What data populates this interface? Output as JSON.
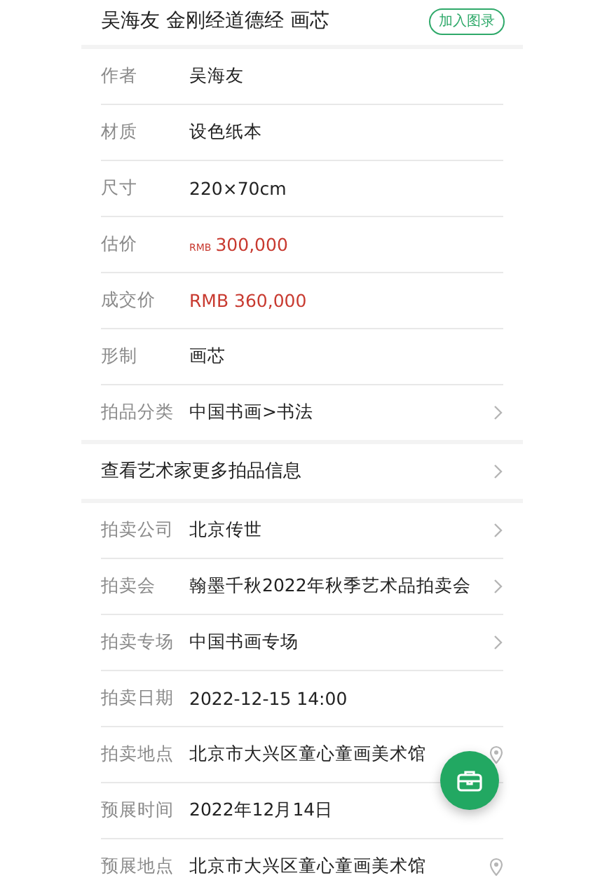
{
  "header": {
    "title": "吴海友 金刚经道德经 画芯",
    "button": "加入图录"
  },
  "groups": [
    {
      "rows": [
        {
          "kind": "field",
          "label": "作者",
          "value": "吴海友",
          "chevron": false,
          "location": false
        },
        {
          "kind": "field",
          "label": "材质",
          "value": "设色纸本",
          "chevron": false,
          "location": false
        },
        {
          "kind": "field",
          "label": "尺寸",
          "value": "220×70cm",
          "chevron": false,
          "location": false
        },
        {
          "kind": "price",
          "label": "估价",
          "currency": "RMB",
          "value": "300,000",
          "chevron": false,
          "location": false
        },
        {
          "kind": "price",
          "label": "成交价",
          "value": "RMB 360,000",
          "chevron": false,
          "location": false
        },
        {
          "kind": "field",
          "label": "形制",
          "value": "画芯",
          "chevron": false,
          "location": false
        },
        {
          "kind": "field",
          "label": "拍品分类",
          "value": "中国书画>书法",
          "chevron": true,
          "location": false
        }
      ]
    },
    {
      "rows": [
        {
          "kind": "link",
          "value": "查看艺术家更多拍品信息",
          "chevron": true,
          "location": false
        }
      ]
    },
    {
      "rows": [
        {
          "kind": "field",
          "label": "拍卖公司",
          "value": "北京传世",
          "chevron": true,
          "location": false
        },
        {
          "kind": "field",
          "label": "拍卖会",
          "value": "翰墨千秋2022年秋季艺术品拍卖会",
          "chevron": true,
          "location": false
        },
        {
          "kind": "field",
          "label": "拍卖专场",
          "value": "中国书画专场",
          "chevron": true,
          "location": false
        },
        {
          "kind": "field",
          "label": "拍卖日期",
          "value": "2022-12-15 14:00",
          "chevron": false,
          "location": false
        },
        {
          "kind": "field",
          "label": "拍卖地点",
          "value": "北京市大兴区童心童画美术馆",
          "chevron": false,
          "location": true
        },
        {
          "kind": "field",
          "label": "预展时间",
          "value": "2022年12月14日",
          "chevron": false,
          "location": false
        },
        {
          "kind": "field",
          "label": "预展地点",
          "value": "北京市大兴区童心童画美术馆",
          "chevron": false,
          "location": true
        }
      ]
    }
  ]
}
